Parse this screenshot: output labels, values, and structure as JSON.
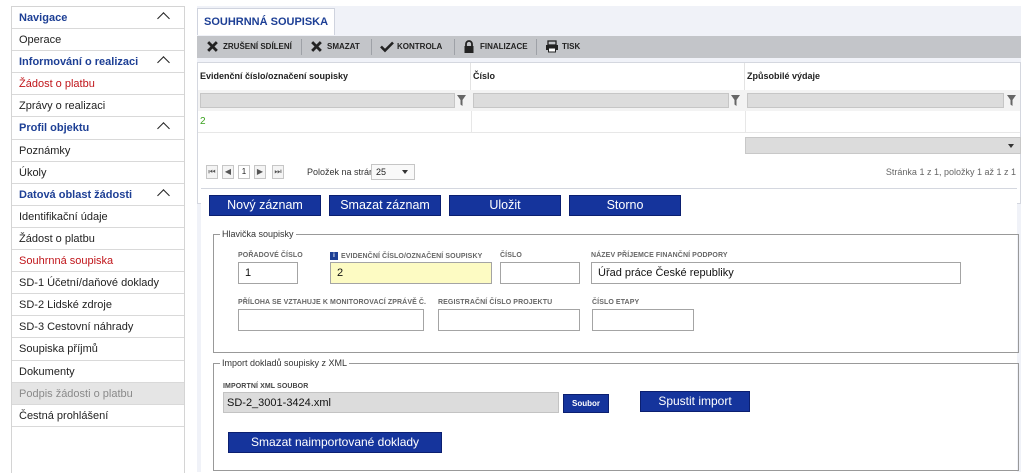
{
  "sidebar": {
    "items": [
      {
        "label": "Navigace",
        "type": "header"
      },
      {
        "label": "Operace",
        "type": "item"
      },
      {
        "label": "Informování o realizaci",
        "type": "header"
      },
      {
        "label": "Žádost o platbu",
        "type": "active"
      },
      {
        "label": "Zprávy o realizaci",
        "type": "item"
      },
      {
        "label": "Profil objektu",
        "type": "header"
      },
      {
        "label": "Poznámky",
        "type": "item"
      },
      {
        "label": "Úkoly",
        "type": "item"
      },
      {
        "label": "Datová oblast žádosti",
        "type": "header"
      },
      {
        "label": "Identifikační údaje",
        "type": "item"
      },
      {
        "label": "Žádost o platbu",
        "type": "item"
      },
      {
        "label": "Souhrnná soupiska",
        "type": "active"
      },
      {
        "label": "SD-1 Účetní/daňové doklady",
        "type": "item"
      },
      {
        "label": "SD-2 Lidské zdroje",
        "type": "item"
      },
      {
        "label": "SD-3 Cestovní náhrady",
        "type": "item"
      },
      {
        "label": "Soupiska příjmů",
        "type": "item"
      },
      {
        "label": "Dokumenty",
        "type": "item"
      },
      {
        "label": "Podpis žádosti o platbu",
        "type": "disabled"
      },
      {
        "label": "Čestná prohlášení",
        "type": "item"
      }
    ]
  },
  "main": {
    "tab": "SOUHRNNÁ SOUPISKA",
    "toolbar": {
      "cancel_sharing": "ZRUŠENÍ SDÍLENÍ",
      "delete": "SMAZAT",
      "check": "KONTROLA",
      "finalize": "FINALIZACE",
      "print": "TISK"
    },
    "grid": {
      "columns": [
        "Evidenční číslo/označení soupisky",
        "Číslo",
        "Způsobilé výdaje"
      ],
      "rows": [
        [
          "2",
          "",
          ""
        ]
      ]
    },
    "pager": {
      "first": "⏮",
      "prev": "◀",
      "page": "1",
      "next": "▶",
      "last": "⏭",
      "per_page_label": "Položek na stránku",
      "per_page_value": "25",
      "info": "Stránka 1 z 1, položky 1 až 1 z 1"
    },
    "actions": {
      "new": "Nový záznam",
      "delete": "Smazat záznam",
      "save": "Uložit",
      "cancel": "Storno"
    },
    "header_box": {
      "legend": "Hlavička soupisky",
      "poradove_label": "POŘADOVÉ ČÍSLO",
      "poradove_value": "1",
      "evidencni_label": "EVIDENČNÍ ČÍSLO/OZNAČENÍ SOUPISKY",
      "evidencni_value": "2",
      "cislo_label": "ČÍSLO",
      "cislo_value": "",
      "nazev_label": "NÁZEV PŘÍJEMCE FINANČNÍ PODPORY",
      "nazev_value": "Úřad práce České republiky",
      "priloha_label": "PŘÍLOHA SE VZTAHUJE K MONITOROVACÍ ZPRÁVĚ Č.",
      "priloha_value": "",
      "registracni_label": "REGISTRAČNÍ ČÍSLO PROJEKTU",
      "registracni_value": "",
      "etapa_label": "ČÍSLO ETAPY",
      "etapa_value": ""
    },
    "import_box": {
      "legend": "Import dokladů soupisky z XML",
      "file_label": "IMPORTNÍ XML SOUBOR",
      "file_value": "SD-2_3001-3424.xml",
      "browse": "Soubor",
      "start": "Spustit import",
      "delete_imported": "Smazat naimportované doklady soupisky"
    }
  },
  "colors": {
    "accent_blue": "#15349c",
    "header_blue": "#1d3f95",
    "active_red": "#c0151a",
    "highlight_yellow": "#fdfbc3",
    "data_green": "#3aa11e"
  }
}
